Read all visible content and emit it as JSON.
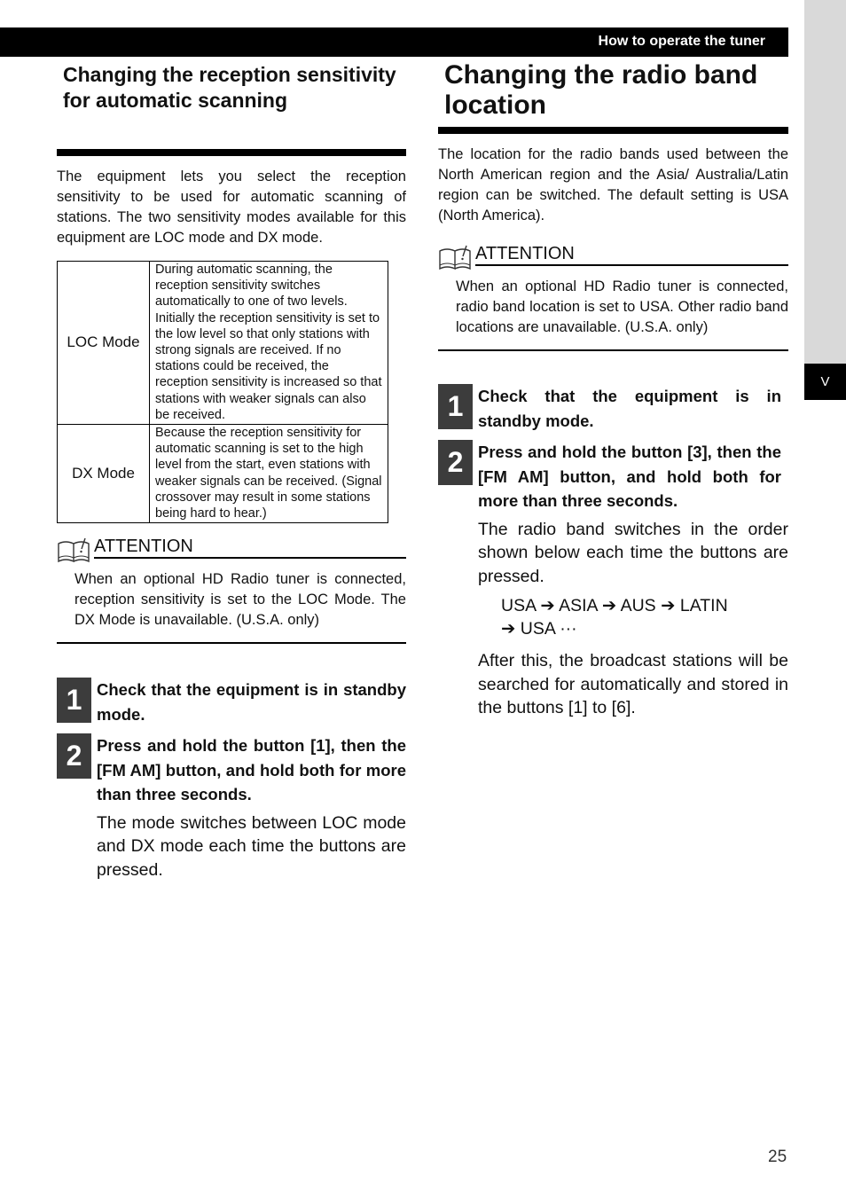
{
  "header": {
    "title": "How to operate the tuner"
  },
  "side_tab": {
    "label": "V"
  },
  "left": {
    "heading": "Changing the reception sensitivity for automatic scanning",
    "intro": "The equipment lets you select the reception sensitivity to be used for automatic scanning of stations. The two sensitivity modes available for this equipment are LOC mode and DX mode.",
    "modes_table": [
      {
        "mode": "LOC Mode",
        "description": "During automatic scanning, the reception sensitivity switches automatically to one of two levels. Initially the reception sensitivity is set to the low level so that only stations with strong signals are received. If no stations could be received, the reception sensitivity is increased so that stations with weaker signals can also be received."
      },
      {
        "mode": "DX Mode",
        "description": "Because the reception sensitivity for automatic scanning is set to the high level from the start, even stations with weaker signals can be received. (Signal crossover may result in some stations being hard to hear.)"
      }
    ],
    "attention": {
      "icon": "book-warning-icon",
      "title": "ATTENTION",
      "text": "When an optional HD Radio tuner is connected, reception sensitivity is set to the LOC Mode. The DX Mode is unavailable. (U.S.A. only)"
    },
    "steps": [
      {
        "number": "1",
        "text": "Check that the equipment is in standby mode."
      },
      {
        "number": "2",
        "text": "Press and hold the button [1], then the [FM AM] button, and hold both for more than three seconds."
      }
    ],
    "step_detail": "The mode switches between LOC mode and DX mode each time the buttons are pressed."
  },
  "right": {
    "heading": "Changing the radio band location",
    "intro": "The location for the radio bands used between the North American region and the Asia/ Australia/Latin region can be switched. The default setting is USA (North America).",
    "attention": {
      "icon": "book-warning-icon",
      "title": "ATTENTION",
      "text": "When an optional HD Radio tuner is connected, radio band location is set to USA. Other radio band locations are unavailable. (U.S.A. only)"
    },
    "steps": [
      {
        "number": "1",
        "text": "Check that the equipment is in standby mode."
      },
      {
        "number": "2",
        "text": "Press and hold the button [3], then the [FM AM] button, and hold both for more than three seconds."
      }
    ],
    "step_detail": "The radio band switches in the order shown below each time the buttons are pressed.",
    "sequence_line1": "USA ➔ ASIA ➔ AUS ➔ LATIN",
    "sequence_line2": "➔ USA ···",
    "after_text": "After this, the broadcast stations will be searched for automatically and stored in the buttons [1] to [6]."
  },
  "footer": {
    "page_number": "25"
  }
}
